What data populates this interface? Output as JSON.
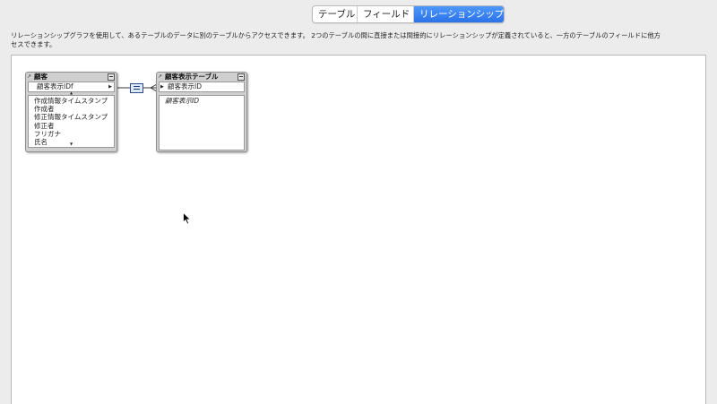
{
  "tabs": [
    {
      "label": "テーブル",
      "selected": false
    },
    {
      "label": "フィールド",
      "selected": false
    },
    {
      "label": "リレーションシップ",
      "selected": true
    }
  ],
  "description": {
    "line1": "リレーションシップグラフを使用して、あるテーブルのデータに別のテーブルからアクセスできます。 2つのテーブルの間に直接または間接的にリレーションシップが定義されていると、一方のテーブルのフィールドに他方",
    "line2": "セスできます。"
  },
  "tables": [
    {
      "title": "顧客",
      "key_field": "顧客表示IDf",
      "fields": [
        "作成情報タイムスタンプ",
        "作成者",
        "修正情報タイムスタンプ",
        "修正者",
        "フリガナ",
        "氏名"
      ]
    },
    {
      "title": "顧客表示テーブル",
      "key_field": "顧客表示ID",
      "fields": [
        "顧客表示ID"
      ]
    }
  ],
  "relationship": {
    "operator": "="
  },
  "colors": {
    "accent": "#2a72e8",
    "table_header": "#cfcfcf",
    "relationship_box": "#dde8f8"
  },
  "icons": [
    "arrow-icon",
    "collapse-icon",
    "relationship-equals-icon",
    "mouse-pointer-icon"
  ]
}
